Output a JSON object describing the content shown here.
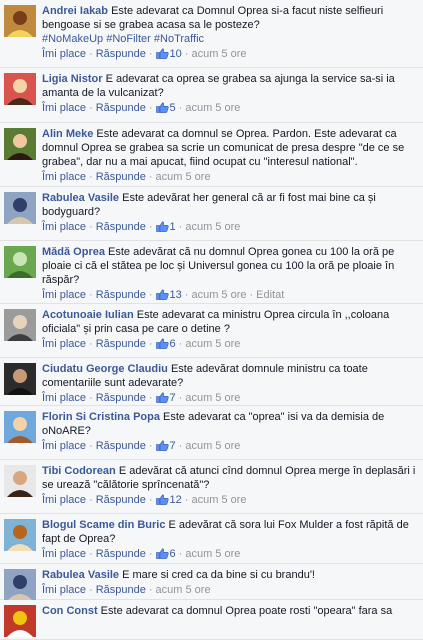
{
  "actions": {
    "like": "Îmi place",
    "reply": "Răspunde",
    "edited": "Editat"
  },
  "comments": [
    {
      "author": "Andrei Iakab",
      "text": "Este adevarat ca Domnul Oprea si-a facut niste selfieuri bengoase si se grabea acasa sa le posteze?",
      "tags": [
        "#NoMakeUp",
        "#NoFilter",
        "#NoTraffic"
      ],
      "likes": "10",
      "time": "acum 5 ore",
      "avatar_colors": [
        "#c08a3e",
        "#7a3d1c",
        "#f2d35b"
      ]
    },
    {
      "author": "Ligia Nistor",
      "text": "E adevarat ca oprea se grabea sa ajunga la service sa-si ia amanta de la vulcanizat?",
      "likes": "5",
      "time": "acum 5 ore",
      "avatar_colors": [
        "#d9534f",
        "#f5d5a8",
        "#4a2a1a"
      ]
    },
    {
      "author": "Alin Meke",
      "text": "Este adevarat ca domnul se Oprea. Pardon. Este adevarat ca domnul Oprea se grabea sa scrie un comunicat de presa despre \"de ce se grabea\", dar nu a mai apucat, fiind ocupat cu \"interesul national\".",
      "likes": "",
      "time": "acum 5 ore",
      "avatar_colors": [
        "#5a7b34",
        "#f0c8a0",
        "#2a1a10"
      ]
    },
    {
      "author": "Rabulea Vasile",
      "text": "Este adevărat her general că ar fi fost mai bine ca și bodyguard?",
      "likes": "1",
      "time": "acum 5 ore",
      "avatar_colors": [
        "#8fa3c2",
        "#2f3f6a",
        "#d8c7b0"
      ]
    },
    {
      "author": "Mădă Oprea",
      "text": "Este adevărat că nu domnul Oprea gonea cu 100 la oră pe ploaie ci că el stătea pe loc și Universul gonea cu 100 la oră pe ploaie în răspăr?",
      "likes": "13",
      "time": "acum 5 ore",
      "edited": true,
      "avatar_colors": [
        "#6aa84f",
        "#c9e5b5",
        "#3a6e2a"
      ]
    },
    {
      "author": "Acotunoaie Iulian",
      "text": "Este adevarat ca ministru Oprea circula în ,,coloana oficiala\" și prin casa pe care o detine ?",
      "likes": "6",
      "time": "acum 5 ore",
      "avatar_colors": [
        "#9b9b9b",
        "#e6d2bd",
        "#3d3d3d"
      ]
    },
    {
      "author": "Ciudatu George Claudiu",
      "text": "Este adevărat domnule ministru ca toate comentariile sunt adevarate?",
      "likes": "7",
      "time": "acum 5 ore",
      "avatar_colors": [
        "#2b2b2b",
        "#c79a76",
        "#111111"
      ]
    },
    {
      "author": "Florin Si Cristina Popa",
      "text": "Este adevarat ca \"oprea\" isi va da demisia de oNoARE?",
      "likes": "7",
      "time": "acum 5 ore",
      "avatar_colors": [
        "#6fa8dc",
        "#f3d2a9",
        "#a05a2c"
      ]
    },
    {
      "author": "Tibi Codorean",
      "text": "E adevărat că atunci cînd domnul Oprea merge în deplasări i se urează \"călătorie sprîncenată\"?",
      "likes": "12",
      "time": "acum 5 ore",
      "avatar_colors": [
        "#e8e8e8",
        "#d9a77e",
        "#3a2418"
      ]
    },
    {
      "author": "Blogul Scame din Buric",
      "text": "E adevărat că sora lui Fox Mulder a fost răpită de fapt de Oprea?",
      "likes": "6",
      "time": "acum 5 ore",
      "avatar_colors": [
        "#7fb3d5",
        "#b5651d",
        "#f5deb3"
      ]
    },
    {
      "author": "Rabulea Vasile",
      "text": "E mare si cred ca da bine si cu brandu'!",
      "likes": "",
      "time": "acum 5 ore",
      "avatar_colors": [
        "#8fa3c2",
        "#2f3f6a",
        "#d8c7b0"
      ]
    },
    {
      "author": "Con Const",
      "text": "Este adevarat ca domnul Oprea poate rosti \"opeara\" fara sa",
      "likes": "",
      "time": "",
      "avatar_colors": [
        "#c0392b",
        "#f1c40f",
        "#ffffff"
      ]
    }
  ]
}
